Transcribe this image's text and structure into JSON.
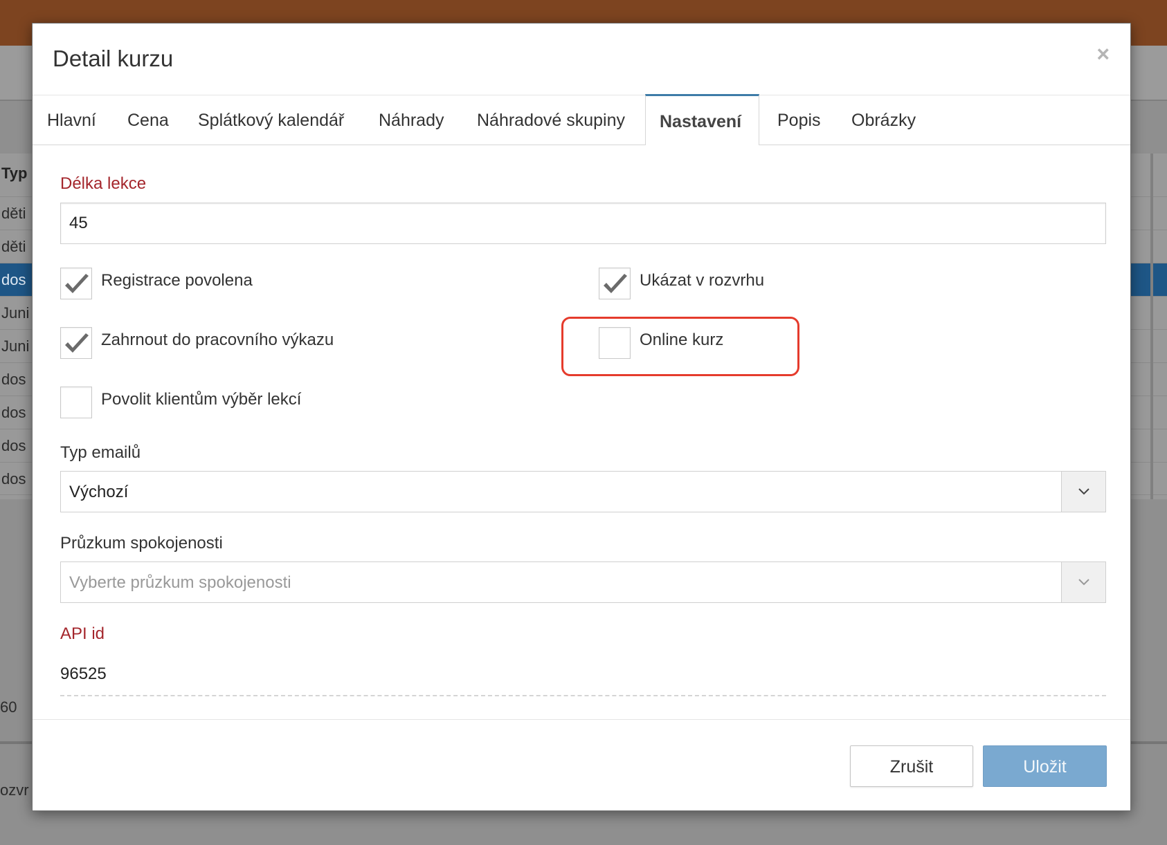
{
  "background": {
    "table_rows": [
      {
        "text": "Typ",
        "kind": "header"
      },
      {
        "text": "děti",
        "kind": "row"
      },
      {
        "text": "děti",
        "kind": "row"
      },
      {
        "text": "dos",
        "kind": "selected"
      },
      {
        "text": "Juni",
        "kind": "row"
      },
      {
        "text": "Juni",
        "kind": "row"
      },
      {
        "text": "dos",
        "kind": "row"
      },
      {
        "text": "dos",
        "kind": "row"
      },
      {
        "text": "dos",
        "kind": "row"
      },
      {
        "text": "dos",
        "kind": "row"
      }
    ],
    "footer_value": "60",
    "footer_text": "ozvr"
  },
  "modal": {
    "title": "Detail kurzu",
    "close_icon": "×",
    "tabs": [
      {
        "label": "Hlavní",
        "active": false
      },
      {
        "label": "Cena",
        "active": false
      },
      {
        "label": "Splátkový kalendář",
        "active": false
      },
      {
        "label": "Náhrady",
        "active": false
      },
      {
        "label": "Náhradové skupiny",
        "active": false
      },
      {
        "label": "Nastavení",
        "active": true
      },
      {
        "label": "Popis",
        "active": false
      },
      {
        "label": "Obrázky",
        "active": false
      }
    ],
    "lesson_length": {
      "label": "Délka lekce",
      "value": "45"
    },
    "checkboxes": [
      {
        "label": "Registrace povolena",
        "checked": true
      },
      {
        "label": "Ukázat v rozvrhu",
        "checked": true
      },
      {
        "label": "Zahrnout do pracovního výkazu",
        "checked": true
      },
      {
        "label": "Online kurz",
        "checked": false
      },
      {
        "label": "Povolit klientům výběr lekcí",
        "checked": false
      }
    ],
    "email_type": {
      "label": "Typ emailů",
      "value": "Výchozí"
    },
    "survey": {
      "label": "Průzkum spokojenosti",
      "placeholder": "Vyberte průzkum spokojenosti"
    },
    "api_id": {
      "label": "API id",
      "value": "96525"
    },
    "buttons": {
      "cancel": "Zrušit",
      "save": "Uložit"
    }
  },
  "colors": {
    "required_label": "#a4262c",
    "highlight": "#e53b2c",
    "save_button": "#7aa9d0",
    "active_tab_border": "#3e7ca8"
  }
}
